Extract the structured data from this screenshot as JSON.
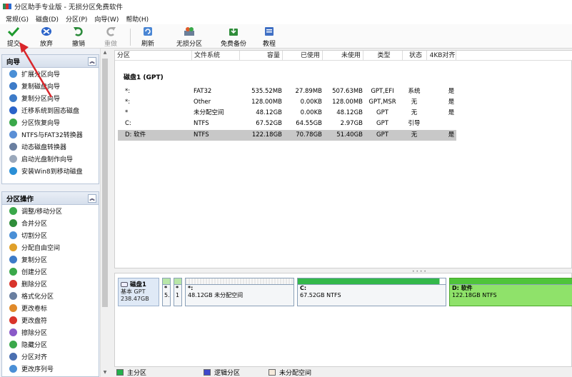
{
  "window": {
    "title": "分区助手专业版 - 无损分区免费软件"
  },
  "menu": [
    "常规(G)",
    "磁盘(D)",
    "分区(P)",
    "向导(W)",
    "帮助(H)"
  ],
  "toolbar": {
    "submit": "提交",
    "discard": "放弃",
    "undo": "撤销",
    "redo": "重做",
    "refresh": "刷新",
    "lossless": "无损分区",
    "backup": "免费备份",
    "tutorial": "教程"
  },
  "wizard": {
    "title": "向导",
    "items": [
      "扩展分区向导",
      "复制磁盘向导",
      "复制分区向导",
      "迁移系统到固态磁盘",
      "分区恢复向导",
      "NTFS与FAT32转换器",
      "动态磁盘转换器",
      "启动光盘制作向导",
      "安装Win8到移动磁盘"
    ]
  },
  "partition_ops": {
    "title": "分区操作",
    "items": [
      "调整/移动分区",
      "合并分区",
      "切割分区",
      "分配自由空间",
      "复制分区",
      "创建分区",
      "删除分区",
      "格式化分区",
      "更改卷标",
      "更改盘符",
      "擦除分区",
      "隐藏分区",
      "分区对齐",
      "更改序列号"
    ]
  },
  "table": {
    "headers": [
      "分区",
      "文件系统",
      "容量",
      "已使用",
      "未使用",
      "类型",
      "状态",
      "4KB对齐"
    ],
    "disk_title": "磁盘1 (GPT)",
    "rows": [
      {
        "partition": "*:",
        "fs": "FAT32",
        "capacity": "535.52MB",
        "used": "27.89MB",
        "unused": "507.63MB",
        "type": "GPT,EFI",
        "status": "系统",
        "align": "是"
      },
      {
        "partition": "*:",
        "fs": "Other",
        "capacity": "128.00MB",
        "used": "0.00KB",
        "unused": "128.00MB",
        "type": "GPT,MSR",
        "status": "无",
        "align": "是"
      },
      {
        "partition": "*",
        "fs": "未分配空间",
        "capacity": "48.12GB",
        "used": "0.00KB",
        "unused": "48.12GB",
        "type": "GPT",
        "status": "无",
        "align": "是"
      },
      {
        "partition": "C:",
        "fs": "NTFS",
        "capacity": "67.52GB",
        "used": "64.55GB",
        "unused": "2.97GB",
        "type": "GPT",
        "status": "引导",
        "align": ""
      },
      {
        "partition": "D: 软件",
        "fs": "NTFS",
        "capacity": "122.18GB",
        "used": "70.78GB",
        "unused": "51.40GB",
        "type": "GPT",
        "status": "无",
        "align": "是"
      }
    ]
  },
  "diskmap": {
    "disk_name": "磁盘1",
    "disk_type": "基本 GPT",
    "disk_size": "238.47GB",
    "parts": [
      {
        "l1": "*",
        "l2": "5."
      },
      {
        "l1": "*",
        "l2": "1"
      },
      {
        "l1": "*:",
        "l2": "48.12GB 未分配空间"
      },
      {
        "l1": "C:",
        "l2": "67.52GB NTFS"
      },
      {
        "l1": "D: 软件",
        "l2": "122.18GB NTFS"
      }
    ]
  },
  "legend": {
    "primary": "主分区",
    "logical": "逻辑分区",
    "unallocated": "未分配空间"
  },
  "colors": {
    "primary": "#22b14c",
    "logical": "#3f48cc",
    "unallocated": "#f5eadc",
    "selected": "#8fe26a",
    "annotation": "#d9262b"
  }
}
